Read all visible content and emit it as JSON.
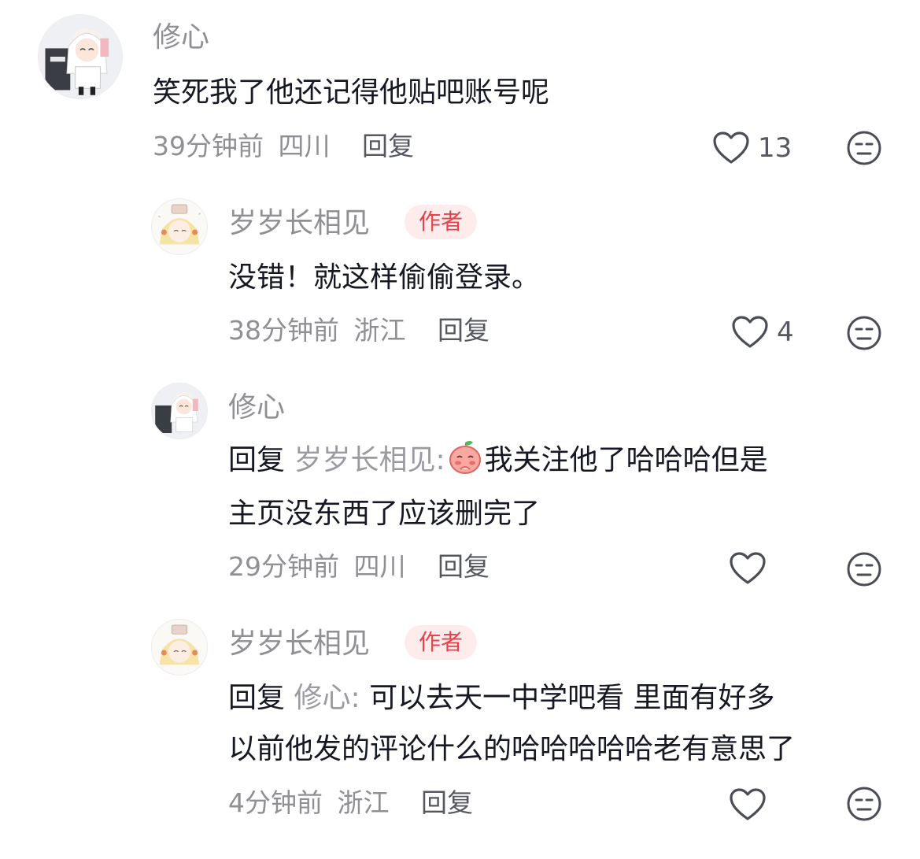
{
  "comments": [
    {
      "username": "修心",
      "is_author": false,
      "text": "笑死我了他还记得他贴吧账号呢",
      "time": "39分钟前",
      "location": "四川",
      "reply_label": "回复",
      "likes": "13"
    },
    {
      "username": "岁岁长相见",
      "is_author": true,
      "author_badge": "作者",
      "text": "没错！就这样偷偷登录。",
      "time": "38分钟前",
      "location": "浙江",
      "reply_label": "回复",
      "likes": "4"
    },
    {
      "username": "修心",
      "is_author": false,
      "reply_prefix": "回复",
      "reply_to": "岁岁长相见:",
      "text_line1": "我关注他了哈哈哈但是",
      "text_line2": "主页没东西了应该删完了",
      "emoji": "shy-peach-emoji",
      "time": "29分钟前",
      "location": "四川",
      "reply_label": "回复",
      "likes": ""
    },
    {
      "username": "岁岁长相见",
      "is_author": true,
      "author_badge": "作者",
      "reply_prefix": "回复",
      "reply_to": "修心:",
      "text_line1": "可以去天一中学吧看 里面有好多",
      "text_line2": "以前他发的评论什么的哈哈哈哈哈老有意思了",
      "time": "4分钟前",
      "location": "浙江",
      "reply_label": "回复",
      "likes": ""
    }
  ],
  "icons": {
    "like": "heart-outline-icon",
    "dislike": "neutral-face-icon"
  },
  "colors": {
    "username": "#8f8f94",
    "body_text": "#161823",
    "meta_text": "#8f8f94",
    "badge_bg": "#fdeceb",
    "badge_text": "#e6424a"
  }
}
